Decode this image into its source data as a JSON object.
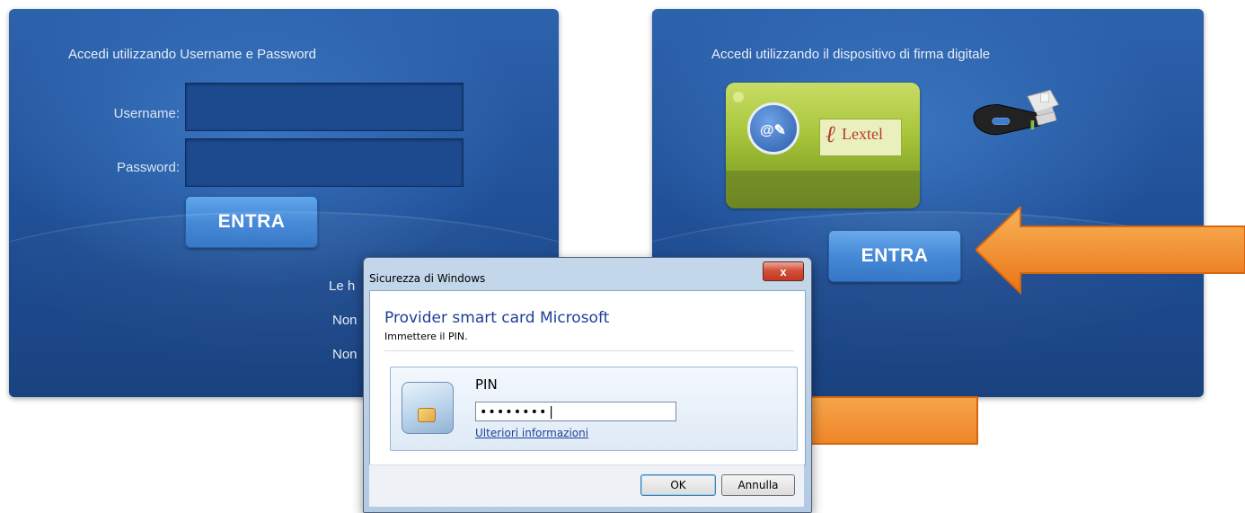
{
  "left_panel": {
    "title": "Accedi utilizzando Username e Password",
    "username_label": "Username:",
    "password_label": "Password:",
    "username_value": "",
    "password_value": "",
    "submit_label": "ENTRA",
    "links": [
      "Le h",
      "Non",
      "Non"
    ]
  },
  "right_panel": {
    "title": "Accedi utilizzando il dispositivo di firma digitale",
    "card_brand": "Lextel",
    "submit_label": "ENTRA"
  },
  "dialog": {
    "window_title": "Sicurezza di Windows",
    "close_glyph": "x",
    "heading": "Provider smart card Microsoft",
    "subheading": "Immettere il PIN.",
    "pin_label": "PIN",
    "pin_value": "••••••••|",
    "more_info_link": "Ulteriori informazioni",
    "ok_label": "OK",
    "cancel_label": "Annulla"
  },
  "colors": {
    "panel_blue": "#2d62ad",
    "button_blue": "#3e85d6",
    "arrow_orange": "#f0841f",
    "card_green": "#a9c63c"
  }
}
